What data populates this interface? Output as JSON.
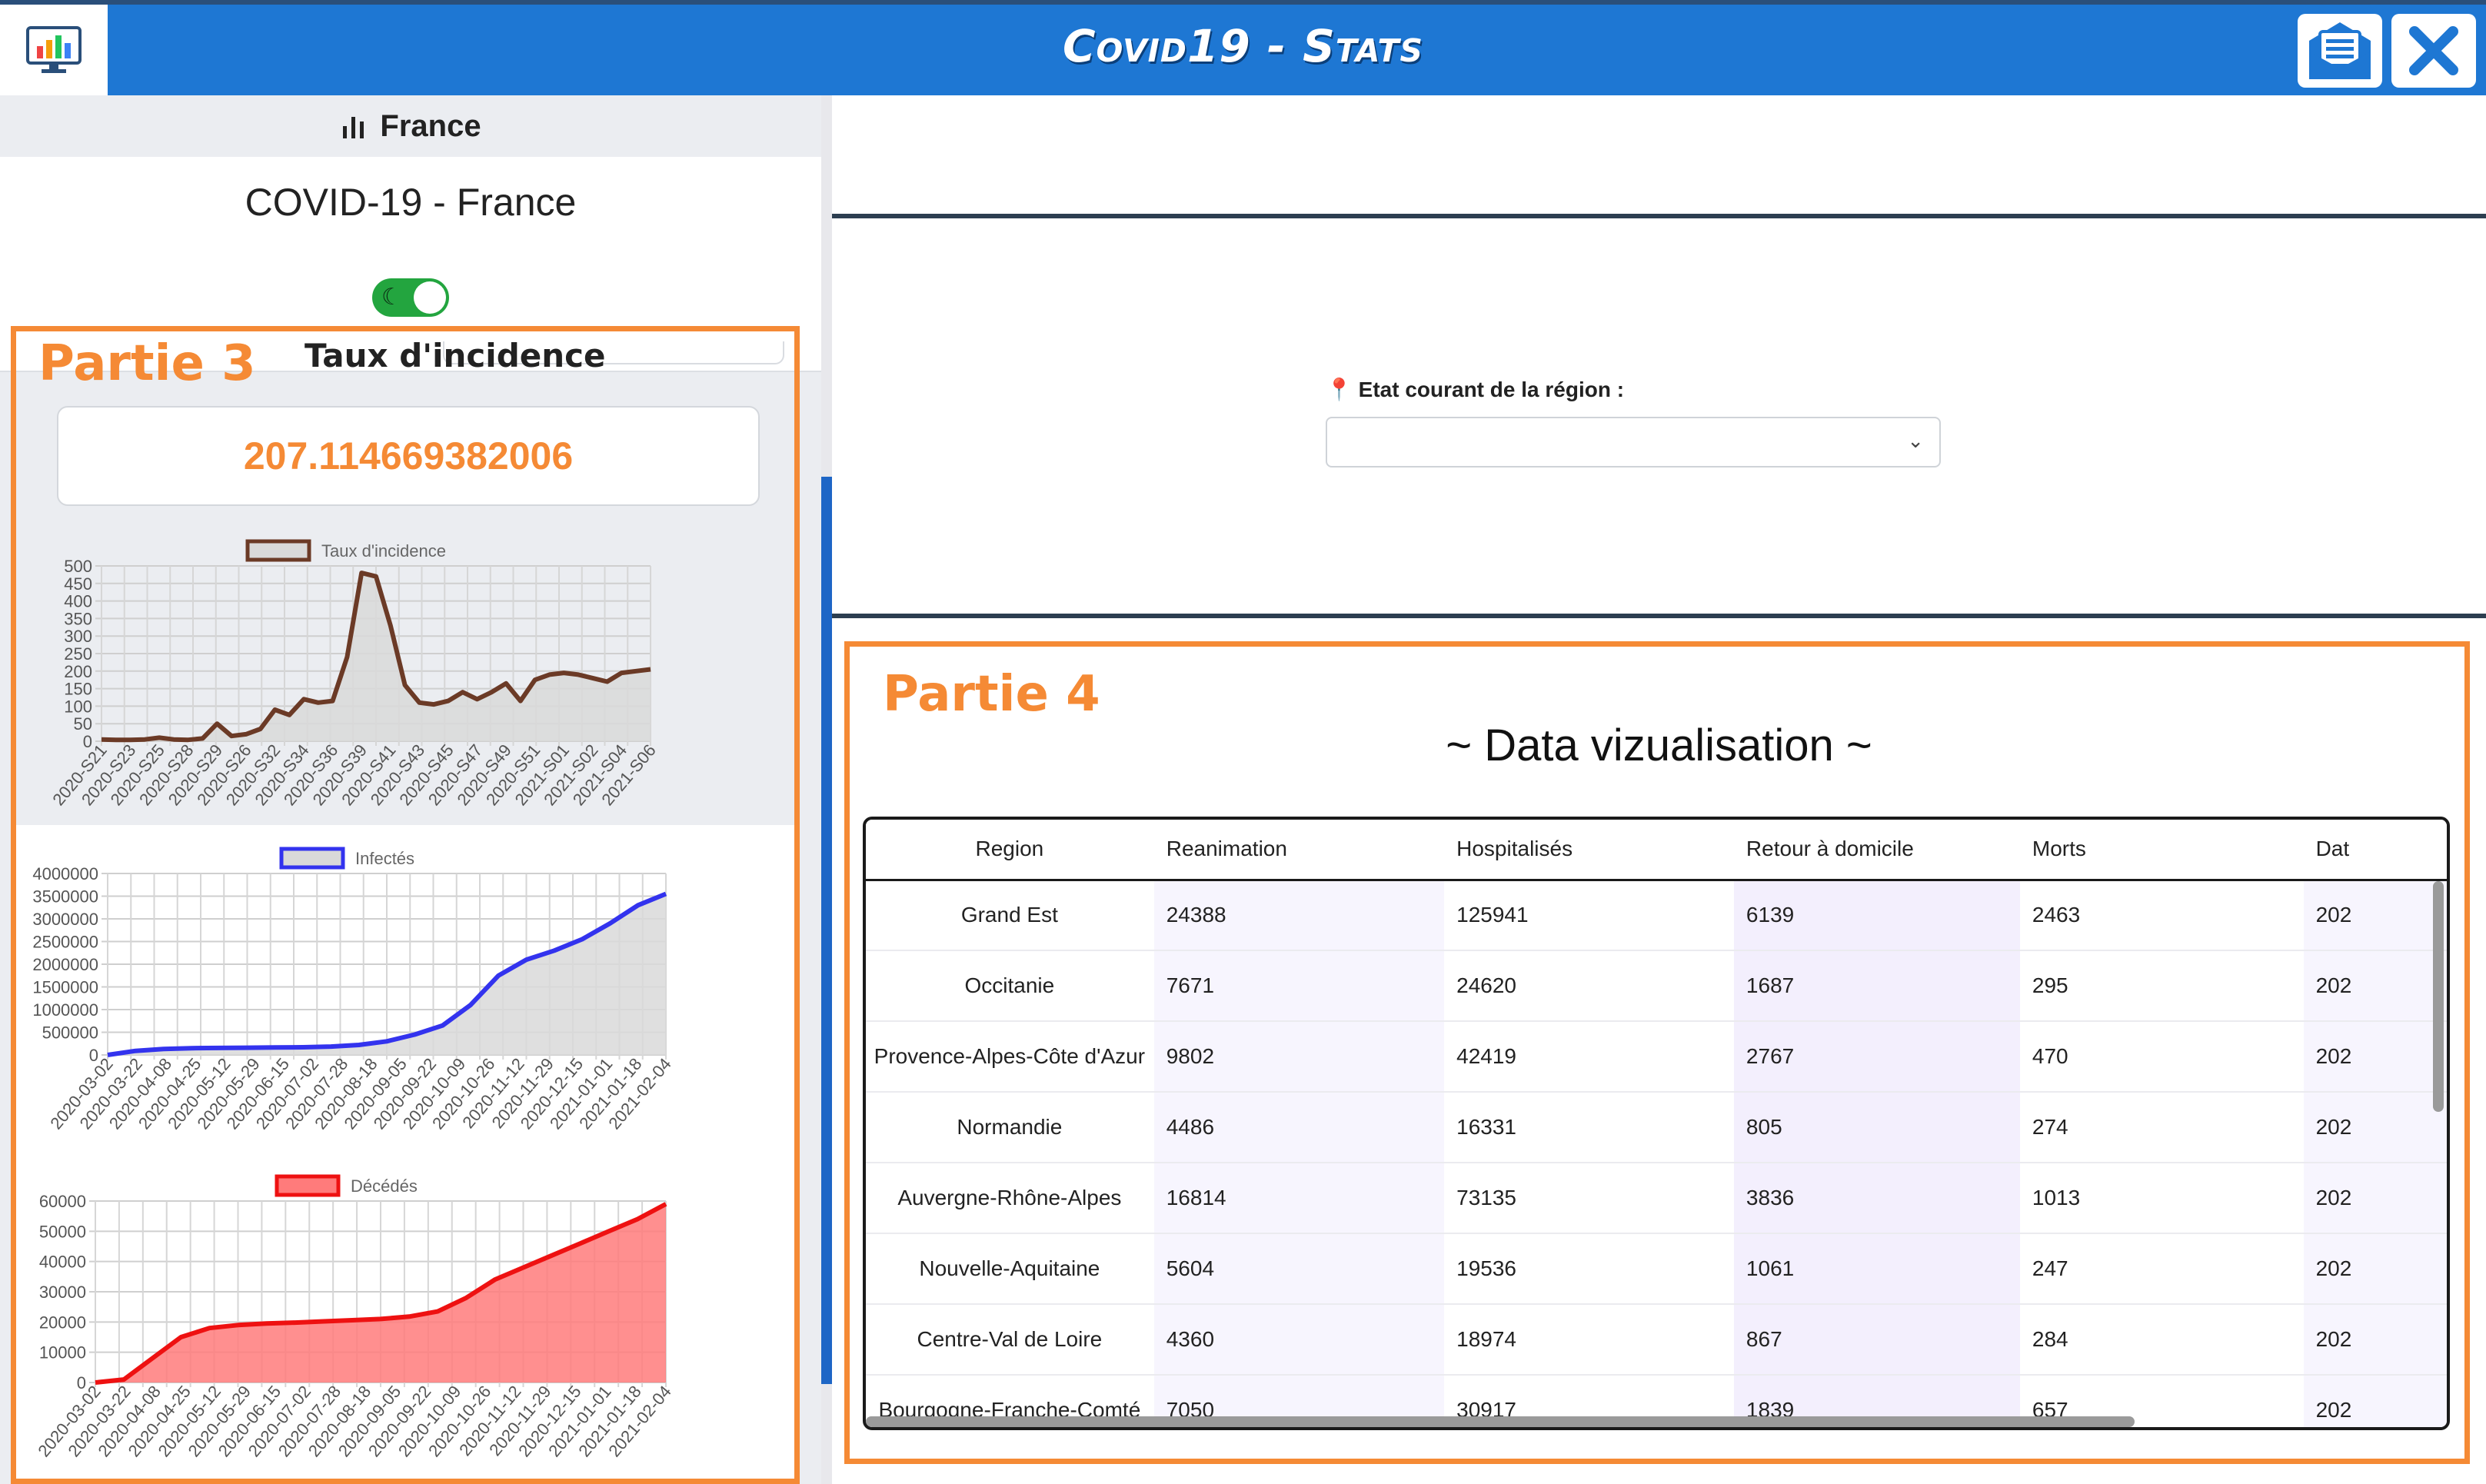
{
  "app": {
    "title": "Covid19 - Stats"
  },
  "icons": {
    "logo": "chart-monitor-logo-icon",
    "mail": "mail-list-icon",
    "close": "close-icon",
    "bar_chart": "bar-chart-icon",
    "map": "map-marker-icon",
    "presentation": "presentation-user-icon",
    "moon": "moon-icon",
    "chevron": "chevron-down-icon"
  },
  "colors": {
    "header": "#1e77d3",
    "accent": "#f58a35",
    "toggle": "#23a53f"
  },
  "left": {
    "tab_label": "France",
    "country_title": "COVID-19 - France",
    "dark_mode_on": true,
    "partie_label": "Partie 3",
    "incidence_title": "Taux d'incidence",
    "incidence_value": "207.114669382006"
  },
  "right": {
    "region_label": "Etat courant de la région :",
    "region_value": "",
    "partie_label": "Partie 4",
    "dataviz_title": "~ Data vizualisation ~",
    "table": {
      "headers": [
        "Region",
        "Reanimation",
        "Hospitalisés",
        "Retour à domicile",
        "Morts",
        "Dat"
      ],
      "rows": [
        [
          "Grand Est",
          "24388",
          "125941",
          "6139",
          "2463",
          "202"
        ],
        [
          "Occitanie",
          "7671",
          "24620",
          "1687",
          "295",
          "202"
        ],
        [
          "Provence-Alpes-Côte d'Azur",
          "9802",
          "42419",
          "2767",
          "470",
          "202"
        ],
        [
          "Normandie",
          "4486",
          "16331",
          "805",
          "274",
          "202"
        ],
        [
          "Auvergne-Rhône-Alpes",
          "16814",
          "73135",
          "3836",
          "1013",
          "202"
        ],
        [
          "Nouvelle-Aquitaine",
          "5604",
          "19536",
          "1061",
          "247",
          "202"
        ],
        [
          "Centre-Val de Loire",
          "4360",
          "18974",
          "867",
          "284",
          "202"
        ],
        [
          "Bourgogne-Franche-Comté",
          "7050",
          "30917",
          "1839",
          "657",
          "202"
        ]
      ]
    }
  },
  "chart_data": [
    {
      "type": "area",
      "legend": [
        "Taux d'incidence"
      ],
      "legend_position": "top",
      "grid": true,
      "ylim": [
        0,
        500
      ],
      "yticks": [
        0,
        50,
        100,
        150,
        200,
        250,
        300,
        350,
        400,
        450,
        500
      ],
      "color": "#6b3a26",
      "fill": "#d9d9d9",
      "x_labels": [
        "2020-S21",
        "2020-S23",
        "2020-S25",
        "2020-S28",
        "2020-S29",
        "2020-S26",
        "2020-S32",
        "2020-S34",
        "2020-S36",
        "2020-S39",
        "2020-S41",
        "2020-S43",
        "2020-S45",
        "2020-S47",
        "2020-S49",
        "2020-S51",
        "2021-S01",
        "2021-S02",
        "2021-S04",
        "2021-S06"
      ],
      "series": [
        {
          "name": "Taux d'incidence",
          "values": [
            5,
            4,
            4,
            5,
            10,
            5,
            4,
            8,
            50,
            15,
            20,
            35,
            90,
            75,
            120,
            110,
            115,
            240,
            480,
            470,
            330,
            160,
            110,
            105,
            115,
            140,
            120,
            140,
            165,
            115,
            175,
            190,
            195,
            190,
            180,
            170,
            195,
            200,
            205
          ]
        }
      ]
    },
    {
      "type": "area",
      "legend": [
        "Infectés"
      ],
      "legend_position": "top",
      "grid": true,
      "ylim": [
        0,
        4000000
      ],
      "yticks": [
        0,
        500000,
        1000000,
        1500000,
        2000000,
        2500000,
        3000000,
        3500000,
        4000000
      ],
      "color": "#3333ee",
      "fill": "#d9d9d9",
      "x_labels": [
        "2020-03-02",
        "2020-03-22",
        "2020-04-08",
        "2020-04-25",
        "2020-05-12",
        "2020-05-29",
        "2020-06-15",
        "2020-07-02",
        "2020-07-28",
        "2020-08-18",
        "2020-09-05",
        "2020-09-22",
        "2020-10-09",
        "2020-10-26",
        "2020-11-12",
        "2020-11-29",
        "2020-12-15",
        "2021-01-01",
        "2021-01-18",
        "2021-02-04"
      ],
      "series": [
        {
          "name": "Infectés",
          "values": [
            0,
            90000,
            130000,
            150000,
            155000,
            160000,
            165000,
            170000,
            185000,
            220000,
            300000,
            450000,
            650000,
            1100000,
            1750000,
            2100000,
            2300000,
            2550000,
            2900000,
            3300000,
            3550000
          ]
        }
      ]
    },
    {
      "type": "area",
      "legend": [
        "Décédés"
      ],
      "legend_position": "top",
      "grid": true,
      "ylim": [
        0,
        60000
      ],
      "yticks": [
        0,
        10000,
        20000,
        30000,
        40000,
        50000,
        60000
      ],
      "color": "#ee1111",
      "fill": "#ff7b7b",
      "x_labels": [
        "2020-03-02",
        "2020-03-22",
        "2020-04-08",
        "2020-04-25",
        "2020-05-12",
        "2020-05-29",
        "2020-06-15",
        "2020-07-02",
        "2020-07-28",
        "2020-08-18",
        "2020-09-05",
        "2020-09-22",
        "2020-10-09",
        "2020-10-26",
        "2020-11-12",
        "2020-11-29",
        "2020-12-15",
        "2021-01-01",
        "2021-01-18",
        "2021-02-04"
      ],
      "series": [
        {
          "name": "Décédés",
          "values": [
            0,
            1000,
            8000,
            15000,
            18000,
            19000,
            19500,
            19800,
            20200,
            20600,
            21000,
            21800,
            23500,
            28000,
            34000,
            38000,
            42000,
            46000,
            50000,
            54000,
            59000
          ]
        }
      ]
    }
  ]
}
